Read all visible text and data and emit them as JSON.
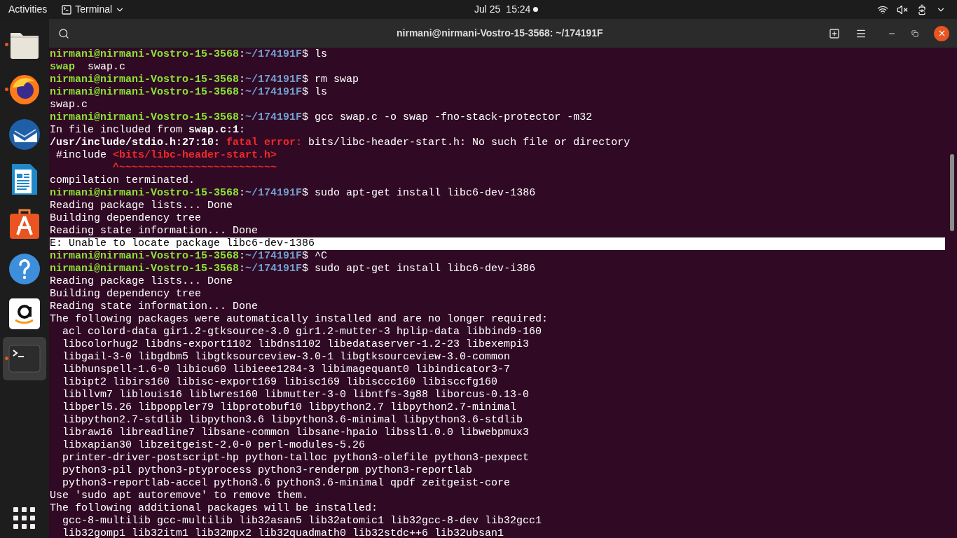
{
  "top_bar": {
    "activities": "Activities",
    "app_menu": "Terminal",
    "date": "Jul 25",
    "time": "15:24"
  },
  "dock": {
    "items": [
      {
        "kind": "files",
        "running": true,
        "selected": false
      },
      {
        "kind": "browser",
        "running": true,
        "selected": false
      },
      {
        "kind": "mail",
        "running": false,
        "selected": false
      },
      {
        "kind": "writer",
        "running": false,
        "selected": false
      },
      {
        "kind": "store",
        "running": false,
        "selected": false
      },
      {
        "kind": "help",
        "running": false,
        "selected": false
      },
      {
        "kind": "shop",
        "running": false,
        "selected": false
      },
      {
        "kind": "terminal",
        "running": true,
        "selected": true
      }
    ]
  },
  "window": {
    "title": "nirmani@nirmani-Vostro-15-3568: ~/174191F"
  },
  "terminal": {
    "lines": [
      {
        "highlighted": false,
        "segments": [
          {
            "kind": "user",
            "text": "nirmani@nirmani-Vostro-15-3568"
          },
          {
            "kind": "plain",
            "text": ":"
          },
          {
            "kind": "path",
            "text": "~/174191F"
          },
          {
            "kind": "plain",
            "text": "$ ls"
          }
        ]
      },
      {
        "highlighted": false,
        "segments": [
          {
            "kind": "exec",
            "text": "swap"
          },
          {
            "kind": "plain",
            "text": "  swap.c"
          }
        ]
      },
      {
        "highlighted": false,
        "segments": [
          {
            "kind": "user",
            "text": "nirmani@nirmani-Vostro-15-3568"
          },
          {
            "kind": "plain",
            "text": ":"
          },
          {
            "kind": "path",
            "text": "~/174191F"
          },
          {
            "kind": "plain",
            "text": "$ rm swap"
          }
        ]
      },
      {
        "highlighted": false,
        "segments": [
          {
            "kind": "user",
            "text": "nirmani@nirmani-Vostro-15-3568"
          },
          {
            "kind": "plain",
            "text": ":"
          },
          {
            "kind": "path",
            "text": "~/174191F"
          },
          {
            "kind": "plain",
            "text": "$ ls"
          }
        ]
      },
      {
        "highlighted": false,
        "segments": [
          {
            "kind": "plain",
            "text": "swap.c"
          }
        ]
      },
      {
        "highlighted": false,
        "segments": [
          {
            "kind": "user",
            "text": "nirmani@nirmani-Vostro-15-3568"
          },
          {
            "kind": "plain",
            "text": ":"
          },
          {
            "kind": "path",
            "text": "~/174191F"
          },
          {
            "kind": "plain",
            "text": "$ gcc swap.c -o swap -fno-stack-protector -m32"
          }
        ]
      },
      {
        "highlighted": false,
        "segments": [
          {
            "kind": "plain",
            "text": "In file included from "
          },
          {
            "kind": "bold",
            "text": "swap.c:1"
          },
          {
            "kind": "plain",
            "text": ":"
          }
        ]
      },
      {
        "highlighted": false,
        "segments": [
          {
            "kind": "bold",
            "text": "/usr/include/stdio.h:27:10: "
          },
          {
            "kind": "error",
            "text": "fatal error: "
          },
          {
            "kind": "plain",
            "text": "bits/libc-header-start.h: No such file or directory"
          }
        ]
      },
      {
        "highlighted": false,
        "segments": [
          {
            "kind": "plain",
            "text": " #include "
          },
          {
            "kind": "error",
            "text": "<bits/libc-header-start.h>"
          }
        ]
      },
      {
        "highlighted": false,
        "segments": [
          {
            "kind": "error",
            "text": "          ^~~~~~~~~~~~~~~~~~~~~~~~~~"
          }
        ]
      },
      {
        "highlighted": false,
        "segments": [
          {
            "kind": "plain",
            "text": "compilation terminated."
          }
        ]
      },
      {
        "highlighted": false,
        "segments": [
          {
            "kind": "user",
            "text": "nirmani@nirmani-Vostro-15-3568"
          },
          {
            "kind": "plain",
            "text": ":"
          },
          {
            "kind": "path",
            "text": "~/174191F"
          },
          {
            "kind": "plain",
            "text": "$ sudo apt-get install libc6-dev-1386"
          }
        ]
      },
      {
        "highlighted": false,
        "segments": [
          {
            "kind": "plain",
            "text": "Reading package lists... Done"
          }
        ]
      },
      {
        "highlighted": false,
        "segments": [
          {
            "kind": "plain",
            "text": "Building dependency tree"
          }
        ]
      },
      {
        "highlighted": false,
        "segments": [
          {
            "kind": "plain",
            "text": "Reading state information... Done"
          }
        ]
      },
      {
        "highlighted": true,
        "segments": [
          {
            "kind": "plain",
            "text": "E: Unable to locate package libc6-dev-1386"
          }
        ]
      },
      {
        "highlighted": false,
        "segments": [
          {
            "kind": "user",
            "text": "nirmani@nirmani-Vostro-15-3568"
          },
          {
            "kind": "plain",
            "text": ":"
          },
          {
            "kind": "path",
            "text": "~/174191F"
          },
          {
            "kind": "plain",
            "text": "$ ^C"
          }
        ]
      },
      {
        "highlighted": false,
        "segments": [
          {
            "kind": "user",
            "text": "nirmani@nirmani-Vostro-15-3568"
          },
          {
            "kind": "plain",
            "text": ":"
          },
          {
            "kind": "path",
            "text": "~/174191F"
          },
          {
            "kind": "plain",
            "text": "$ sudo apt-get install libc6-dev-i386"
          }
        ]
      },
      {
        "highlighted": false,
        "segments": [
          {
            "kind": "plain",
            "text": "Reading package lists... Done"
          }
        ]
      },
      {
        "highlighted": false,
        "segments": [
          {
            "kind": "plain",
            "text": "Building dependency tree"
          }
        ]
      },
      {
        "highlighted": false,
        "segments": [
          {
            "kind": "plain",
            "text": "Reading state information... Done"
          }
        ]
      },
      {
        "highlighted": false,
        "segments": [
          {
            "kind": "plain",
            "text": "The following packages were automatically installed and are no longer required:"
          }
        ]
      },
      {
        "highlighted": false,
        "segments": [
          {
            "kind": "plain",
            "text": "  acl colord-data gir1.2-gtksource-3.0 gir1.2-mutter-3 hplip-data libbind9-160"
          }
        ]
      },
      {
        "highlighted": false,
        "segments": [
          {
            "kind": "plain",
            "text": "  libcolorhug2 libdns-export1102 libdns1102 libedataserver-1.2-23 libexempi3"
          }
        ]
      },
      {
        "highlighted": false,
        "segments": [
          {
            "kind": "plain",
            "text": "  libgail-3-0 libgdbm5 libgtksourceview-3.0-1 libgtksourceview-3.0-common"
          }
        ]
      },
      {
        "highlighted": false,
        "segments": [
          {
            "kind": "plain",
            "text": "  libhunspell-1.6-0 libicu60 libieee1284-3 libimagequant0 libindicator3-7"
          }
        ]
      },
      {
        "highlighted": false,
        "segments": [
          {
            "kind": "plain",
            "text": "  libipt2 libirs160 libisc-export169 libisc169 libisccc160 libisccfg160"
          }
        ]
      },
      {
        "highlighted": false,
        "segments": [
          {
            "kind": "plain",
            "text": "  libllvm7 liblouis16 liblwres160 libmutter-3-0 libntfs-3g88 liborcus-0.13-0"
          }
        ]
      },
      {
        "highlighted": false,
        "segments": [
          {
            "kind": "plain",
            "text": "  libperl5.26 libpoppler79 libprotobuf10 libpython2.7 libpython2.7-minimal"
          }
        ]
      },
      {
        "highlighted": false,
        "segments": [
          {
            "kind": "plain",
            "text": "  libpython2.7-stdlib libpython3.6 libpython3.6-minimal libpython3.6-stdlib"
          }
        ]
      },
      {
        "highlighted": false,
        "segments": [
          {
            "kind": "plain",
            "text": "  libraw16 libreadline7 libsane-common libsane-hpaio libssl1.0.0 libwebpmux3"
          }
        ]
      },
      {
        "highlighted": false,
        "segments": [
          {
            "kind": "plain",
            "text": "  libxapian30 libzeitgeist-2.0-0 perl-modules-5.26"
          }
        ]
      },
      {
        "highlighted": false,
        "segments": [
          {
            "kind": "plain",
            "text": "  printer-driver-postscript-hp python-talloc python3-olefile python3-pexpect"
          }
        ]
      },
      {
        "highlighted": false,
        "segments": [
          {
            "kind": "plain",
            "text": "  python3-pil python3-ptyprocess python3-renderpm python3-reportlab"
          }
        ]
      },
      {
        "highlighted": false,
        "segments": [
          {
            "kind": "plain",
            "text": "  python3-reportlab-accel python3.6 python3.6-minimal qpdf zeitgeist-core"
          }
        ]
      },
      {
        "highlighted": false,
        "segments": [
          {
            "kind": "plain",
            "text": "Use 'sudo apt autoremove' to remove them."
          }
        ]
      },
      {
        "highlighted": false,
        "segments": [
          {
            "kind": "plain",
            "text": "The following additional packages will be installed:"
          }
        ]
      },
      {
        "highlighted": false,
        "segments": [
          {
            "kind": "plain",
            "text": "  gcc-8-multilib gcc-multilib lib32asan5 lib32atomic1 lib32gcc-8-dev lib32gcc1"
          }
        ]
      },
      {
        "highlighted": false,
        "segments": [
          {
            "kind": "plain",
            "text": "  lib32gomp1 lib32itm1 lib32mpx2 lib32quadmath0 lib32stdc++6 lib32ubsan1"
          }
        ]
      }
    ]
  }
}
